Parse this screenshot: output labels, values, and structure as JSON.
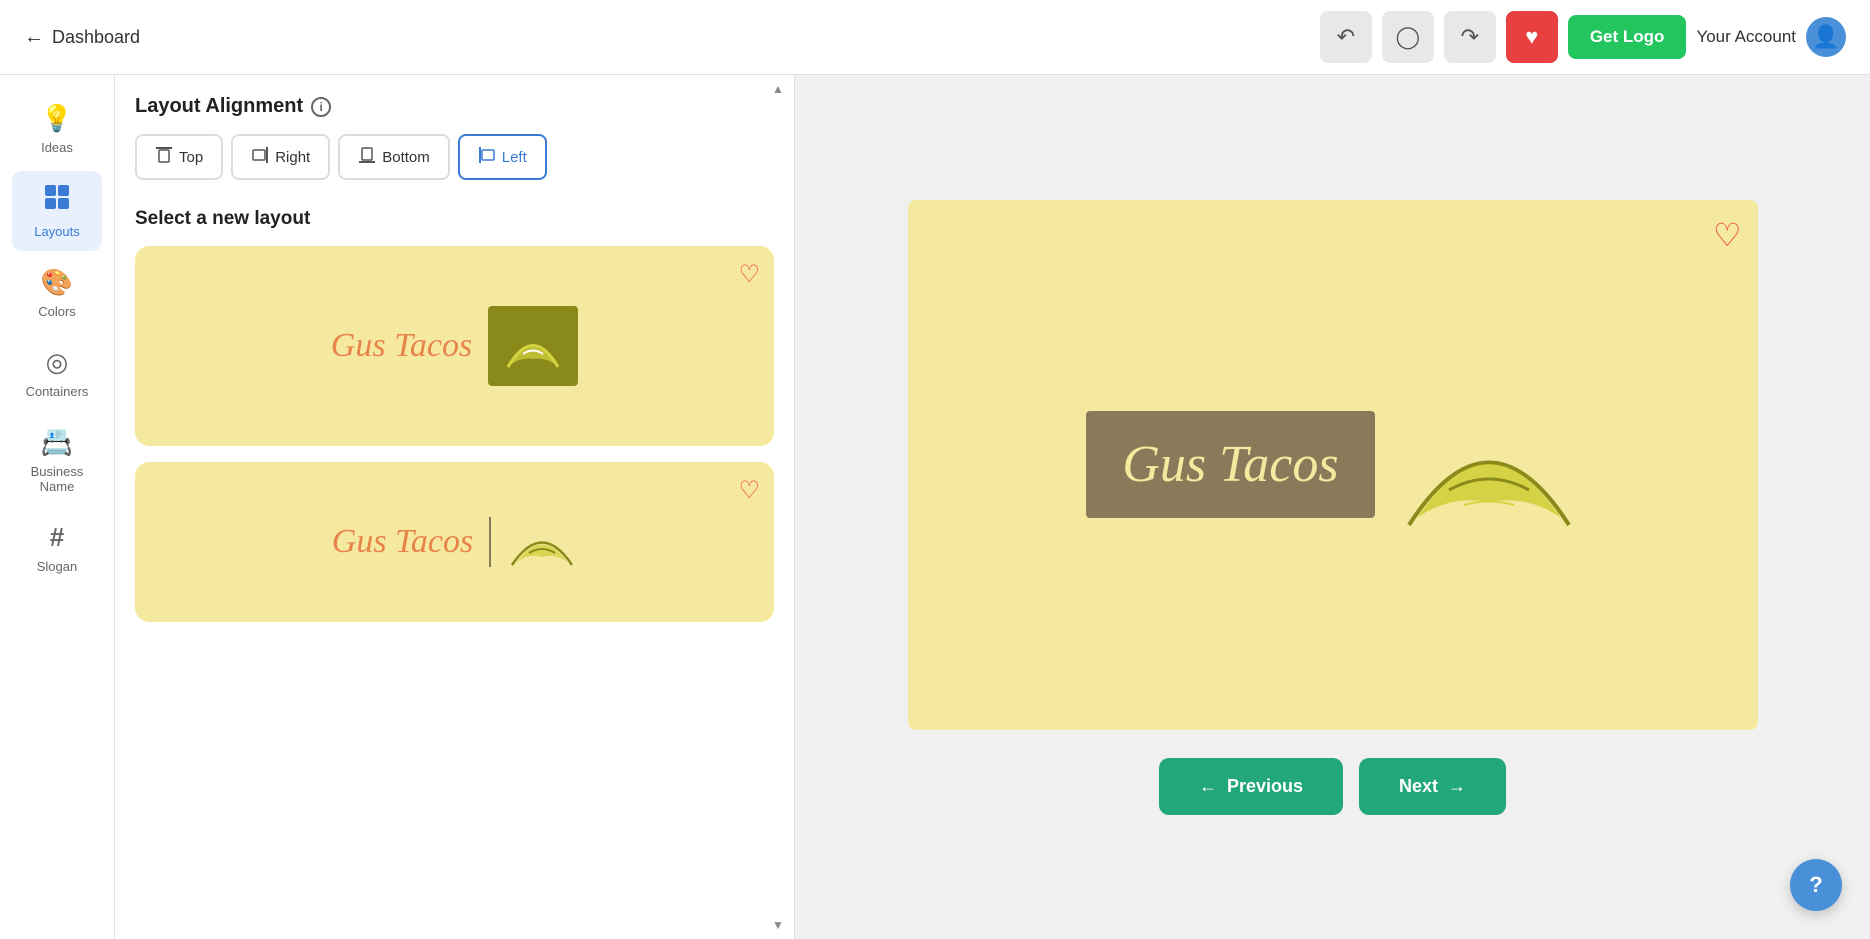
{
  "header": {
    "back_label": "Dashboard",
    "get_logo_label": "Get Logo",
    "your_account_label": "Your Account"
  },
  "toolbar": {
    "undo_icon": "undo",
    "history_icon": "history",
    "redo_icon": "redo",
    "heart_icon": "heart"
  },
  "sidebar": {
    "items": [
      {
        "id": "ideas",
        "label": "Ideas",
        "icon": "💡"
      },
      {
        "id": "layouts",
        "label": "Layouts",
        "icon": "⊞",
        "active": true
      },
      {
        "id": "colors",
        "label": "Colors",
        "icon": "🎨"
      },
      {
        "id": "containers",
        "label": "Containers",
        "icon": "◎"
      },
      {
        "id": "business-name",
        "label": "Business Name",
        "icon": "📇"
      },
      {
        "id": "slogan",
        "label": "Slogan",
        "icon": "#"
      }
    ]
  },
  "panel": {
    "alignment_title": "Layout Alignment",
    "alignment_buttons": [
      {
        "id": "top",
        "label": "Top"
      },
      {
        "id": "right",
        "label": "Right"
      },
      {
        "id": "bottom",
        "label": "Bottom"
      },
      {
        "id": "left",
        "label": "Left",
        "active": true
      }
    ],
    "layout_section_title": "Select a new layout",
    "layout_cards": [
      {
        "id": "card1",
        "brand": "Gus Tacos"
      },
      {
        "id": "card2",
        "brand": "Gus Tacos"
      }
    ]
  },
  "preview": {
    "brand_name": "Gus Tacos",
    "heart_icon": "heart"
  },
  "navigation": {
    "previous_label": "Previous",
    "next_label": "Next"
  },
  "help": {
    "label": "?"
  }
}
